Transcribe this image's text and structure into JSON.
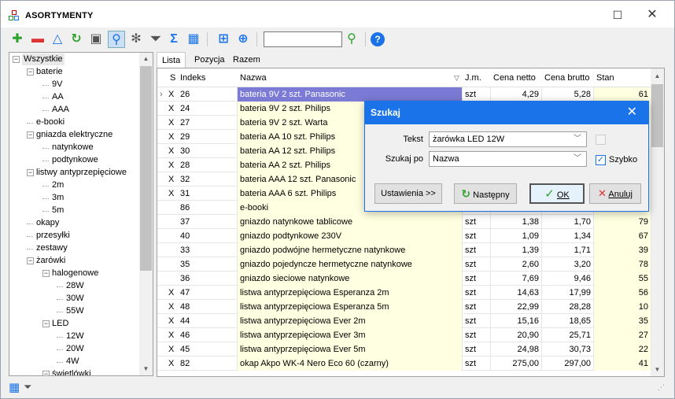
{
  "window": {
    "title": "ASORTYMENTY",
    "minimize_icon": "minimize-icon",
    "close_icon": "close-icon"
  },
  "toolbar": {
    "buttons": [
      "add-icon",
      "remove-icon",
      "filter-triangle-icon",
      "refresh-icon",
      "print-icon",
      "search-icon",
      "settings-icon",
      "filter-icon",
      "sum-icon",
      "columns-icon",
      "export-icon",
      "web-icon",
      "find-icon",
      "help-icon"
    ],
    "search_value": ""
  },
  "tree": {
    "items": [
      {
        "label": "Wszystkie",
        "level": 0
      },
      {
        "label": "baterie",
        "level": 1
      },
      {
        "label": "9V",
        "level": 2
      },
      {
        "label": "AA",
        "level": 2
      },
      {
        "label": "AAA",
        "level": 2
      },
      {
        "label": "e-booki",
        "level": 1
      },
      {
        "label": "gniazda elektryczne",
        "level": 1
      },
      {
        "label": "natynkowe",
        "level": 2
      },
      {
        "label": "podtynkowe",
        "level": 2
      },
      {
        "label": "listwy antyprzepięciowe",
        "level": 1
      },
      {
        "label": "2m",
        "level": 2
      },
      {
        "label": "3m",
        "level": 2
      },
      {
        "label": "5m",
        "level": 2
      },
      {
        "label": "okapy",
        "level": 1
      },
      {
        "label": "przesyłki",
        "level": 1
      },
      {
        "label": "zestawy",
        "level": 1
      },
      {
        "label": "żarówki",
        "level": 1
      },
      {
        "label": "halogenowe",
        "level": 2
      },
      {
        "label": "28W",
        "level": 3
      },
      {
        "label": "30W",
        "level": 3
      },
      {
        "label": "55W",
        "level": 3
      },
      {
        "label": "LED",
        "level": 2
      },
      {
        "label": "12W",
        "level": 3
      },
      {
        "label": "20W",
        "level": 3
      },
      {
        "label": "4W",
        "level": 3
      },
      {
        "label": "świetlówki",
        "level": 2
      }
    ]
  },
  "tabs": [
    "Lista",
    "Pozycja",
    "Razem"
  ],
  "grid": {
    "columns": [
      "S",
      "Indeks",
      "Nazwa",
      "J.m.",
      "Cena netto",
      "Cena brutto",
      "Stan"
    ],
    "rows": [
      [
        "X",
        "26",
        "bateria 9V 2 szt. Panasonic",
        "szt",
        "4,29",
        "5,28",
        "61"
      ],
      [
        "X",
        "24",
        "bateria 9V 2 szt. Philips",
        "",
        "",
        "",
        ""
      ],
      [
        "X",
        "27",
        "bateria 9V 2 szt. Warta",
        "",
        "",
        "",
        ""
      ],
      [
        "X",
        "29",
        "bateria AA 10 szt. Philips",
        "",
        "",
        "",
        ""
      ],
      [
        "X",
        "30",
        "bateria AA 12 szt. Philips",
        "",
        "",
        "",
        ""
      ],
      [
        "X",
        "28",
        "bateria AA 2 szt. Philips",
        "",
        "",
        "",
        ""
      ],
      [
        "X",
        "32",
        "bateria AAA 12 szt. Panasonic",
        "",
        "",
        "",
        ""
      ],
      [
        "X",
        "31",
        "bateria AAA 6 szt. Philips",
        "",
        "",
        "",
        ""
      ],
      [
        "",
        "86",
        "e-booki",
        "",
        "",
        "",
        ""
      ],
      [
        "",
        "37",
        "gniazdo natynkowe tablicowe",
        "szt",
        "1,38",
        "1,70",
        "79"
      ],
      [
        "",
        "40",
        "gniazdo podtynkowe 230V",
        "szt",
        "1,09",
        "1,34",
        "67"
      ],
      [
        "",
        "33",
        "gniazdo podwójne hermetyczne natynkowe",
        "szt",
        "1,39",
        "1,71",
        "39"
      ],
      [
        "",
        "35",
        "gniazdo pojedyncze hermetyczne natynkowe",
        "szt",
        "2,60",
        "3,20",
        "78"
      ],
      [
        "",
        "36",
        "gniazdo sieciowe natynkowe",
        "szt",
        "7,69",
        "9,46",
        "55"
      ],
      [
        "X",
        "47",
        "listwa antyprzepięciowa Esperanza 2m",
        "szt",
        "14,63",
        "17,99",
        "56"
      ],
      [
        "X",
        "48",
        "listwa antyprzepięciowa Esperanza 5m",
        "szt",
        "22,99",
        "28,28",
        "10"
      ],
      [
        "X",
        "44",
        "listwa antyprzepięciowa Ever 2m",
        "szt",
        "15,16",
        "18,65",
        "35"
      ],
      [
        "X",
        "46",
        "listwa antyprzepięciowa Ever 3m",
        "szt",
        "20,90",
        "25,71",
        "27"
      ],
      [
        "X",
        "45",
        "listwa antyprzepięciowa Ever 5m",
        "szt",
        "24,98",
        "30,73",
        "22"
      ],
      [
        "X",
        "82",
        "okap Akpo WK-4 Nero Eco 60 (czarny)",
        "szt",
        "275,00",
        "297,00",
        "41"
      ]
    ]
  },
  "dialog": {
    "title": "Szukaj",
    "text_label": "Tekst",
    "text_value": "żarówka LED 12W",
    "searchby_label": "Szukaj po",
    "searchby_value": "Nazwa",
    "fast_label": "Szybko",
    "buttons": {
      "settings": "Ustawienia >>",
      "next": "Następny",
      "ok": "OK",
      "cancel": "Anuluj"
    }
  }
}
